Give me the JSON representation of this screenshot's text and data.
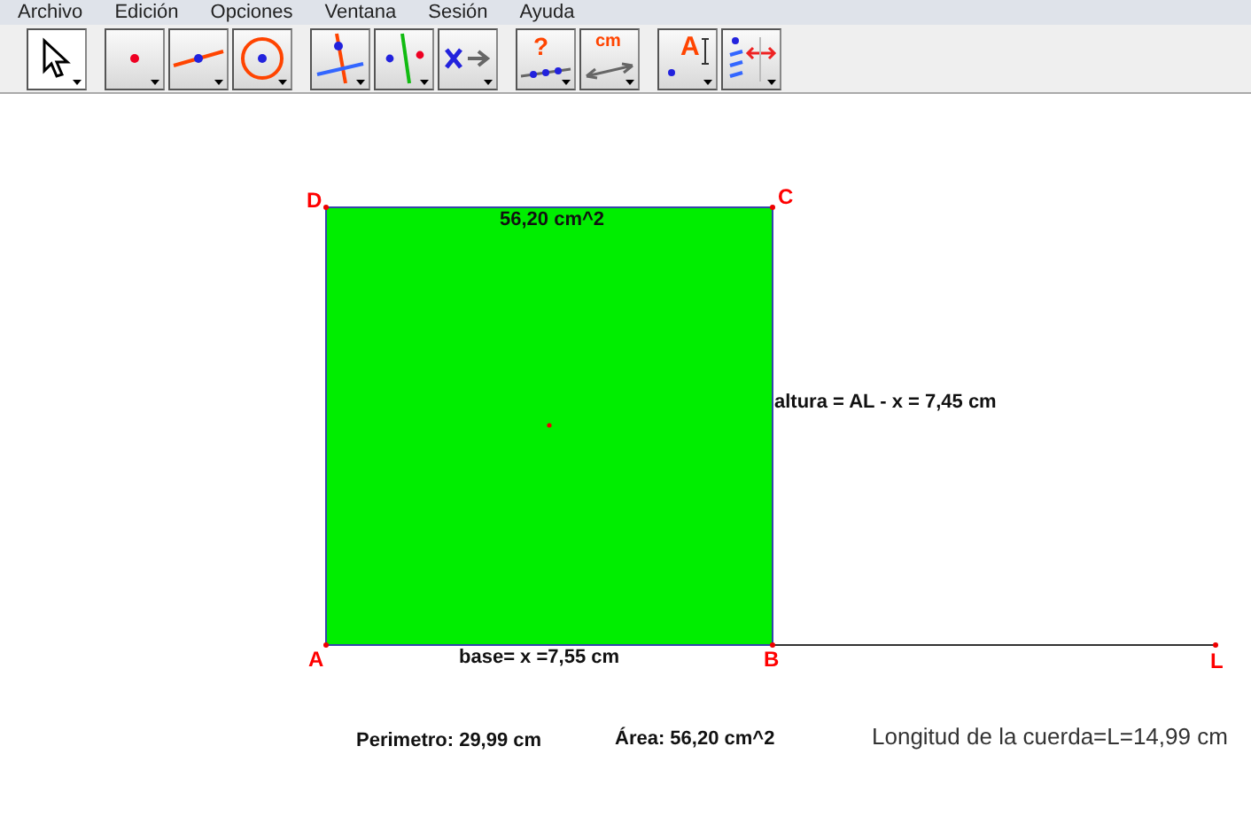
{
  "menu": [
    "Archivo",
    "Edición",
    "Opciones",
    "Ventana",
    "Sesión",
    "Ayuda"
  ],
  "toolbar": [
    [
      {
        "kind": "pointer",
        "selected": true
      }
    ],
    [
      {
        "kind": "point",
        "selected": false
      },
      {
        "kind": "line",
        "selected": false
      },
      {
        "kind": "circle",
        "selected": false
      }
    ],
    [
      {
        "kind": "perpendicular",
        "selected": false
      },
      {
        "kind": "parallel",
        "selected": false
      },
      {
        "kind": "transform",
        "selected": false
      }
    ],
    [
      {
        "kind": "query",
        "selected": false,
        "text": "?"
      },
      {
        "kind": "measure",
        "selected": false,
        "text": "cm"
      }
    ],
    [
      {
        "kind": "label",
        "selected": false,
        "text": "A"
      },
      {
        "kind": "display",
        "selected": false
      }
    ]
  ],
  "points": [
    {
      "name": "D"
    },
    {
      "name": "C"
    },
    {
      "name": "A"
    },
    {
      "name": "B"
    },
    {
      "name": "L"
    }
  ],
  "square_area": "56,20 cm^2",
  "height_label": "altura = AL - x = 7,45 cm",
  "base_label": "base= x =7,55 cm",
  "perimeter": "Perimetro: 29,99 cm",
  "area": "Área: 56,20 cm^2",
  "rope_length": "Longitud de la cuerda=L=14,99 cm"
}
